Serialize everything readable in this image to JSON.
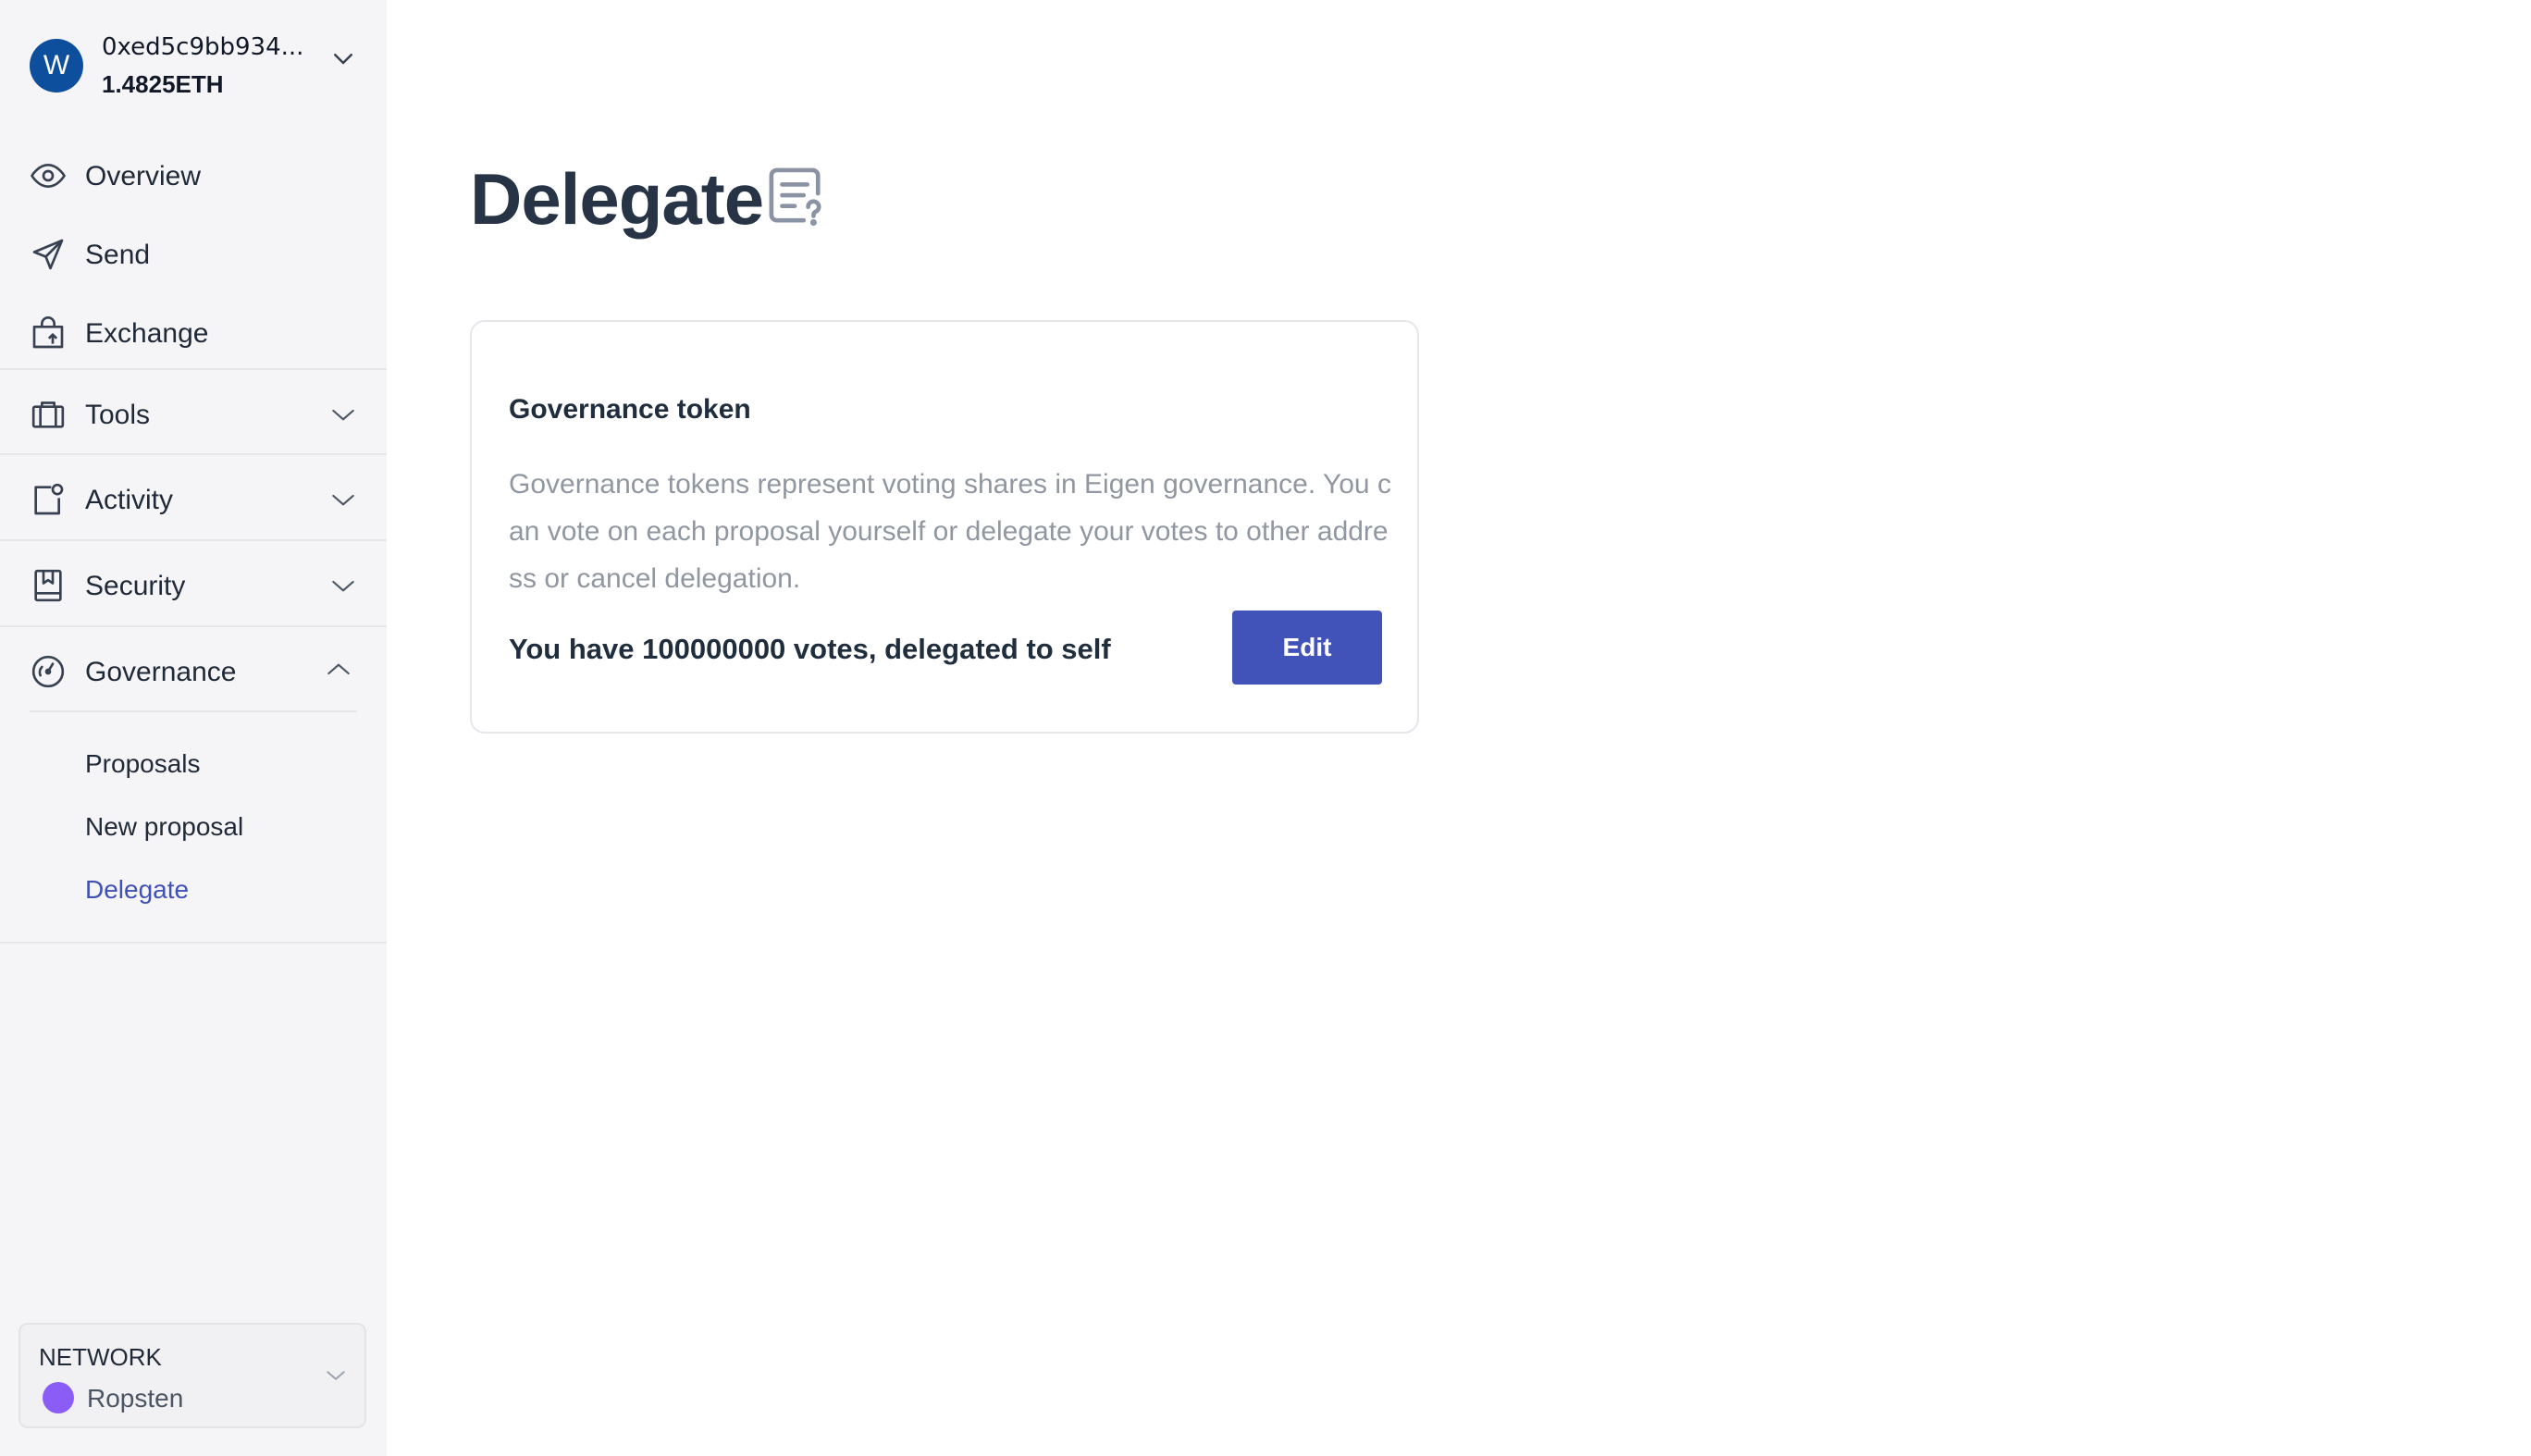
{
  "account": {
    "avatar_letter": "W",
    "address": "0xed5c9bb934...",
    "balance": "1.4825ETH"
  },
  "nav": {
    "overview": "Overview",
    "send": "Send",
    "exchange": "Exchange",
    "tools": "Tools",
    "activity": "Activity",
    "security": "Security",
    "governance": "Governance",
    "governance_items": [
      "Proposals",
      "New proposal",
      "Delegate"
    ],
    "active_item": "Delegate"
  },
  "network": {
    "label": "NETWORK",
    "name": "Ropsten",
    "dot_color": "#8b5cf6"
  },
  "page": {
    "title": "Delegate"
  },
  "card": {
    "title": "Governance token",
    "description": "Governance tokens represent voting shares in Eigen governance. You can vote on each proposal yourself or delegate your votes to other address or cancel delegation.",
    "votes_text": "You have 100000000 votes, delegated to self",
    "edit_label": "Edit"
  },
  "colors": {
    "accent": "#3f51b5",
    "button": "#4152b8",
    "avatar": "#0d4f9c",
    "sidebar_bg": "#f5f5f7"
  }
}
